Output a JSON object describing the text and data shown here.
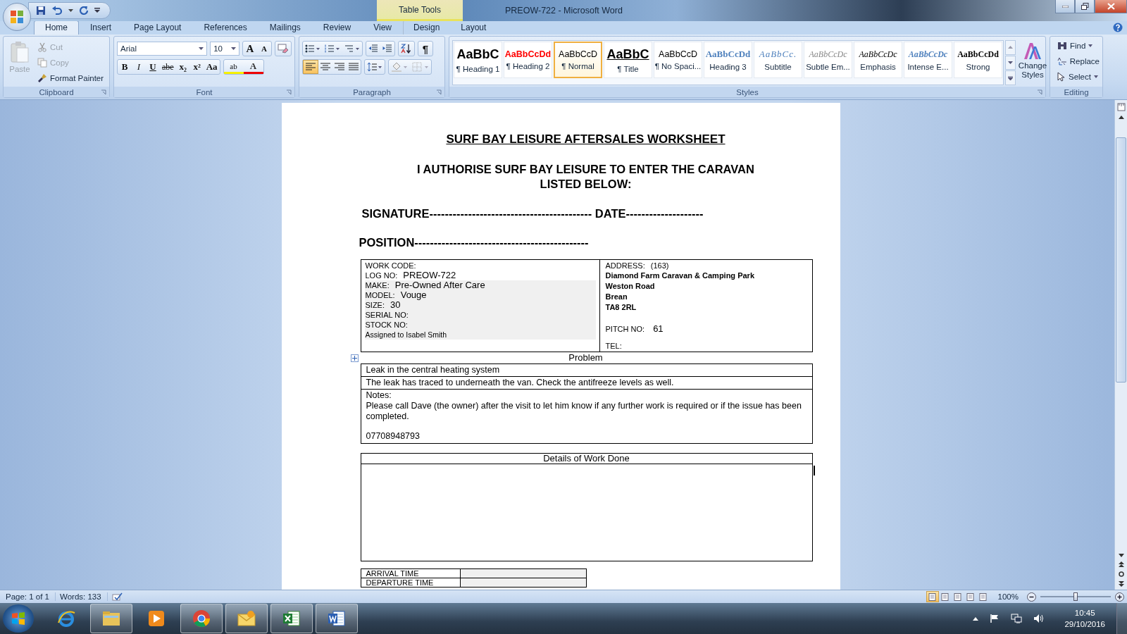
{
  "title_bar": {
    "context": "Table Tools",
    "title": "PREOW-722 - Microsoft Word"
  },
  "tabs": [
    {
      "label": "Home",
      "selected": true,
      "kind": "main"
    },
    {
      "label": "Insert",
      "selected": false,
      "kind": "main"
    },
    {
      "label": "Page Layout",
      "selected": false,
      "kind": "main"
    },
    {
      "label": "References",
      "selected": false,
      "kind": "main"
    },
    {
      "label": "Mailings",
      "selected": false,
      "kind": "main"
    },
    {
      "label": "Review",
      "selected": false,
      "kind": "main"
    },
    {
      "label": "View",
      "selected": false,
      "kind": "main"
    },
    {
      "label": "Design",
      "selected": false,
      "kind": "table"
    },
    {
      "label": "Layout",
      "selected": false,
      "kind": "table"
    }
  ],
  "clipboard": {
    "group": "Clipboard",
    "paste": {
      "label": "Paste",
      "disabled": true
    },
    "items": [
      {
        "label": "Cut",
        "kind": "cut",
        "disabled": true
      },
      {
        "label": "Copy",
        "kind": "copy",
        "disabled": true
      },
      {
        "label": "Format Painter",
        "kind": "painter",
        "disabled": false
      }
    ]
  },
  "font": {
    "group": "Font",
    "name": "Arial",
    "size": "10",
    "grow": "A",
    "shrink": "A",
    "buttons": [
      {
        "label": "B",
        "kind": "bold"
      },
      {
        "label": "I",
        "kind": "italic"
      },
      {
        "label": "U",
        "kind": "underline"
      },
      {
        "label": "abe",
        "kind": "strike"
      },
      {
        "label": "x₂",
        "kind": "sub"
      },
      {
        "label": "x²",
        "kind": "sup"
      },
      {
        "label": "Aa",
        "kind": "case"
      },
      {
        "label": "ab",
        "kind": "highlight"
      },
      {
        "label": "A",
        "kind": "color"
      }
    ]
  },
  "paragraph": {
    "group": "Paragraph",
    "pilcrow": "¶",
    "alignments": [
      {
        "selected": true
      },
      {
        "selected": false
      },
      {
        "selected": false
      },
      {
        "selected": false
      }
    ]
  },
  "styles": {
    "group": "Styles",
    "change": "Change Styles",
    "items": [
      {
        "preview": "AaBbC",
        "label": "¶ Heading 1",
        "kind": "heading1",
        "selected": false
      },
      {
        "preview": "AaBbCcDd",
        "label": "¶ Heading 2",
        "kind": "heading2",
        "selected": false
      },
      {
        "preview": "AaBbCcD",
        "label": "¶ Normal",
        "kind": "normal",
        "selected": true
      },
      {
        "preview": "AaBbC",
        "label": "¶ Title",
        "kind": "title",
        "selected": false
      },
      {
        "preview": "AaBbCcD",
        "label": "¶ No Spaci...",
        "kind": "normal",
        "selected": false
      },
      {
        "preview": "AaBbCcDd",
        "label": "Heading 3",
        "kind": "heading3",
        "selected": false
      },
      {
        "preview": "AaBbCc.",
        "label": "Subtitle",
        "kind": "subtitle",
        "selected": false
      },
      {
        "preview": "AaBbCcDc",
        "label": "Subtle Em...",
        "kind": "subtle",
        "selected": false
      },
      {
        "preview": "AaBbCcDc",
        "label": "Emphasis",
        "kind": "emphasis",
        "selected": false
      },
      {
        "preview": "AaBbCcDc",
        "label": "Intense E...",
        "kind": "intense",
        "selected": false
      },
      {
        "preview": "AaBbCcDd",
        "label": "Strong",
        "kind": "strong",
        "selected": false
      }
    ]
  },
  "editing": {
    "group": "Editing",
    "items": [
      {
        "label": "Find",
        "kind": "find"
      },
      {
        "label": "Replace",
        "kind": "replace"
      },
      {
        "label": "Select",
        "kind": "select"
      }
    ]
  },
  "document": {
    "title": "SURF BAY LEISURE AFTERSALES WORKSHEET",
    "authorise": [
      "I AUTHORISE SURF BAY LEISURE TO ENTER THE CARAVAN",
      "LISTED BELOW:"
    ],
    "signature": "SIGNATURE------------------------------------------ DATE--------------------",
    "position": "POSITION---------------------------------------------",
    "details": [
      {
        "label": "WORK CODE:",
        "shaded": false
      },
      {
        "label": "LOG NO:",
        "value": "PREOW-722",
        "shaded": false
      },
      {
        "label": "MAKE:",
        "value": "Pre-Owned  After Care",
        "shaded": true
      },
      {
        "label": "MODEL:",
        "value": "Vouge",
        "shaded": true
      },
      {
        "label": "SIZE:",
        "value": "30",
        "shaded": true
      },
      {
        "label": "SERIAL  NO:",
        "shaded": true
      },
      {
        "label": "STOCK NO:",
        "shaded": true
      }
    ],
    "assigned": "Assigned to Isabel Smith",
    "address_label": "ADDRESS:",
    "address_code": "(163)",
    "address_lines": [
      "Diamond Farm Caravan  & Camping Park",
      "Weston Road",
      "Brean",
      "TA8 2RL"
    ],
    "pitch_label": "PITCH NO:",
    "pitch": "61",
    "tel_label": "TEL:",
    "problem_caption": "Problem",
    "problem": "Leak in the central heating system",
    "finding": "The leak has traced to underneath the van. Check the antifreeze levels as well.",
    "notes_label": "Notes:",
    "notes": "Please call Dave (the owner) after the visit to let him know if any further work is required or if the issue has been completed.",
    "phone": "07708948793",
    "work_done": "Details of Work Done",
    "times": [
      "ARRIVAL  TIME",
      "DEPARTURE  TIME"
    ]
  },
  "status_bar": {
    "page": "Page: 1 of 1",
    "words": "Words: 133",
    "views": [
      {
        "selected": true
      },
      {
        "selected": false
      },
      {
        "selected": false
      },
      {
        "selected": false
      },
      {
        "selected": false
      }
    ],
    "zoom": "100%",
    "zoom_slider": {
      "level": 0.5
    }
  },
  "taskbar": {
    "apps": [
      {
        "kind": "ie",
        "open": false
      },
      {
        "kind": "explorer",
        "open": true
      },
      {
        "kind": "media",
        "open": false
      },
      {
        "kind": "chrome",
        "open": true
      },
      {
        "kind": "mail",
        "open": true
      },
      {
        "kind": "excel",
        "open": true
      },
      {
        "kind": "word",
        "open": true
      }
    ],
    "time": "10:45",
    "date": "29/10/2016"
  }
}
